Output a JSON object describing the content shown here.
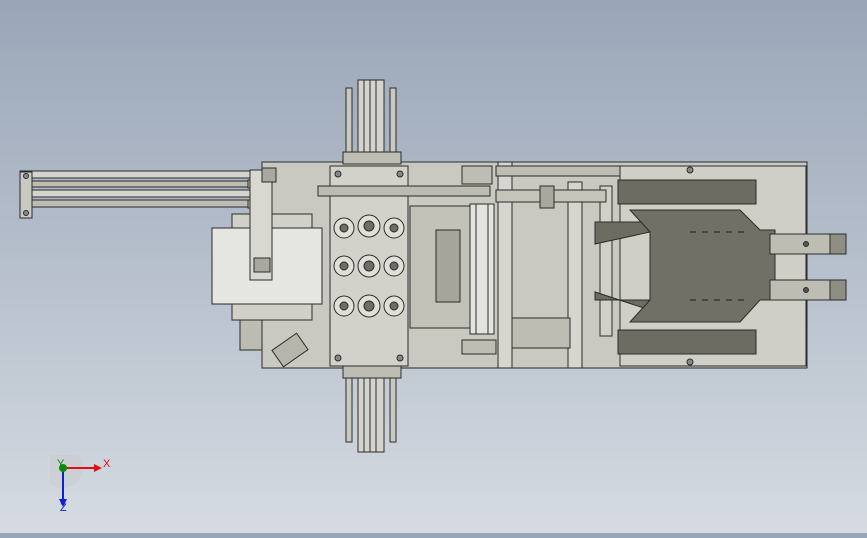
{
  "view": {
    "background_top": "#9aa6b8",
    "background_bottom": "#d6dbe2",
    "part_fill": "#c9c9c1",
    "part_dark": "#7d7d72",
    "outline": "#2b2b2b"
  },
  "triad": {
    "x_label": "X",
    "y_label": "Y",
    "z_label": "Z",
    "x_color": "#e01010",
    "y_color": "#0a8a0a",
    "z_color": "#1020d0"
  }
}
